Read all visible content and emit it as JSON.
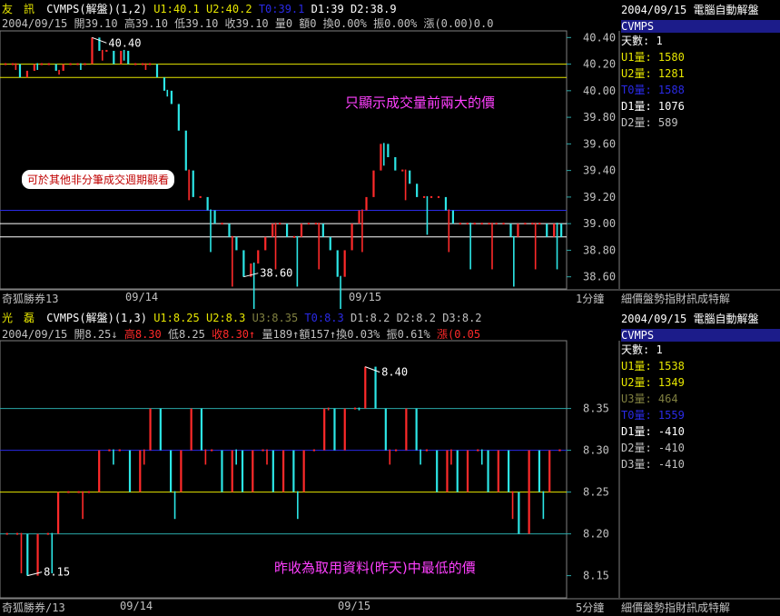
{
  "colors": {
    "bg": "#000000",
    "up": "#ff2a2a",
    "down": "#2ce6e6",
    "yellow": "#e6e600",
    "blue": "#2a2ae6",
    "white": "#ffffff",
    "grid": "#808080",
    "teal": "#2aa8a8"
  },
  "top": {
    "name": "友　訊",
    "indicator": "CVMPS(解盤)(1,2)",
    "u1": "U1:40.1",
    "u2": "U2:40.2",
    "t0": "T0:39.1",
    "d1": "D1:39",
    "d2": "D2:38.9",
    "info": "2004/09/15 開39.10 高39.10 低39.10 收39.10 量0 額0 換0.00% 振0.00% 漲(0.00)0.0",
    "note": "只顯示成交量前兩大的價",
    "bubble": "可於其他非分筆成交週期觀看",
    "footer_broker": "奇狐勝券13",
    "period": "1分鐘",
    "sidebar": {
      "title": "2004/09/15 電腦自動解盤",
      "header": "CVMPS",
      "rows": [
        "天數: 1",
        "U1量: 1580",
        "U2量: 1281",
        "T0量: 1588",
        "D1量: 1076",
        "D2量: 589"
      ],
      "footer": "細價盤勢指財訊成特解"
    }
  },
  "bottom": {
    "name": "光　磊",
    "indicator": "CVMPS(解盤)(1,3)",
    "u1": "U1:8.25",
    "u2": "U2:8.3",
    "u3": "U3:8.35",
    "t0": "T0:8.3",
    "d1": "D1:8.2",
    "d2": "D2:8.2",
    "d3": "D3:8.2",
    "info_a": "2004/09/15 開8.25↓",
    "info_b": "高8.30",
    "info_c": "低8.25",
    "info_d": "收8.30↑",
    "info_e": "量189↑額157↑換0.03% 振0.61%",
    "info_f": "漲(0.05",
    "note": "昨收為取用資料(昨天)中最低的價",
    "footer_broker": "奇狐勝券/13",
    "period": "5分鐘",
    "sidebar": {
      "title": "2004/09/15 電腦自動解盤",
      "header": "CVMPS",
      "rows": [
        "天數: 1",
        "U1量: 1538",
        "U2量: 1349",
        "U3量: 464",
        "T0量: 1559",
        "D1量: -410",
        "D2量: -410",
        "D3量: -410"
      ],
      "footer": "細價盤勢指財訊成特解"
    }
  },
  "chart_data": [
    {
      "type": "line",
      "title": "友訊 CVMPS(解盤)(1,2)",
      "x_labels": [
        "09/14",
        "09/15"
      ],
      "ylim": [
        38.5,
        40.5
      ],
      "y_ticks": [
        40.4,
        40.2,
        40.0,
        39.8,
        39.6,
        39.4,
        39.2,
        39.0,
        38.8,
        38.6
      ],
      "levels": [
        {
          "name": "U1",
          "value": 40.1,
          "color": "#e6e600"
        },
        {
          "name": "U2",
          "value": 40.2,
          "color": "#e6e600"
        },
        {
          "name": "T0",
          "value": 39.1,
          "color": "#2a2ae6"
        },
        {
          "name": "D1",
          "value": 39.0,
          "color": "#ffffff"
        },
        {
          "name": "D2",
          "value": 38.9,
          "color": "#ffffff"
        }
      ],
      "annotations": [
        {
          "label": "40.40",
          "value": 40.4
        },
        {
          "label": "38.60",
          "value": 38.6
        }
      ],
      "price_path": [
        40.2,
        40.2,
        40.1,
        40.15,
        40.2,
        40.2,
        40.2,
        40.15,
        40.2,
        40.2,
        40.2,
        40.2,
        40.4,
        40.3,
        40.3,
        40.2,
        40.3,
        40.2,
        40.2,
        40.2,
        40.2,
        40.1,
        40.0,
        39.9,
        39.7,
        39.4,
        39.2,
        39.2,
        39.1,
        39.0,
        39.0,
        38.9,
        38.8,
        38.6,
        38.7,
        38.8,
        38.9,
        39.0,
        39.0,
        38.9,
        38.9,
        39.0,
        39.0,
        39.0,
        38.9,
        38.8,
        38.6,
        38.8,
        39.0,
        39.1,
        39.2,
        39.4,
        39.6,
        39.5,
        39.4,
        39.4,
        39.3,
        39.2,
        39.2,
        39.2,
        39.2,
        39.1,
        39.0,
        39.0,
        39.0,
        39.0,
        39.0,
        39.0,
        39.0,
        39.0,
        38.9,
        39.0,
        39.0,
        39.0,
        39.0,
        38.9,
        39.0,
        38.9
      ]
    },
    {
      "type": "line",
      "title": "光磊 CVMPS(解盤)(1,3)",
      "x_labels": [
        "09/14",
        "09/15"
      ],
      "ylim": [
        8.14,
        8.42
      ],
      "y_ticks": [
        8.35,
        8.3,
        8.25,
        8.2,
        8.15
      ],
      "levels": [
        {
          "name": "U3",
          "value": 8.35,
          "color": "#2aa8a8"
        },
        {
          "name": "T0",
          "value": 8.3,
          "color": "#2a2ae6"
        },
        {
          "name": "U1",
          "value": 8.25,
          "color": "#e6e600"
        },
        {
          "name": "D1",
          "value": 8.2,
          "color": "#2aa8a8"
        }
      ],
      "annotations": [
        {
          "label": "8.40",
          "value": 8.4
        },
        {
          "label": "8.15",
          "value": 8.15
        }
      ],
      "price_path": [
        8.2,
        8.2,
        8.15,
        8.2,
        8.2,
        8.25,
        8.25,
        8.25,
        8.25,
        8.3,
        8.3,
        8.3,
        8.25,
        8.3,
        8.35,
        8.3,
        8.25,
        8.3,
        8.35,
        8.3,
        8.3,
        8.25,
        8.3,
        8.25,
        8.3,
        8.3,
        8.25,
        8.3,
        8.25,
        8.3,
        8.3,
        8.35,
        8.3,
        8.35,
        8.35,
        8.4,
        8.35,
        8.3,
        8.3,
        8.35,
        8.3,
        8.3,
        8.25,
        8.3,
        8.25,
        8.3,
        8.3,
        8.25,
        8.3,
        8.25,
        8.2,
        8.3,
        8.25,
        8.3,
        8.3
      ]
    }
  ]
}
